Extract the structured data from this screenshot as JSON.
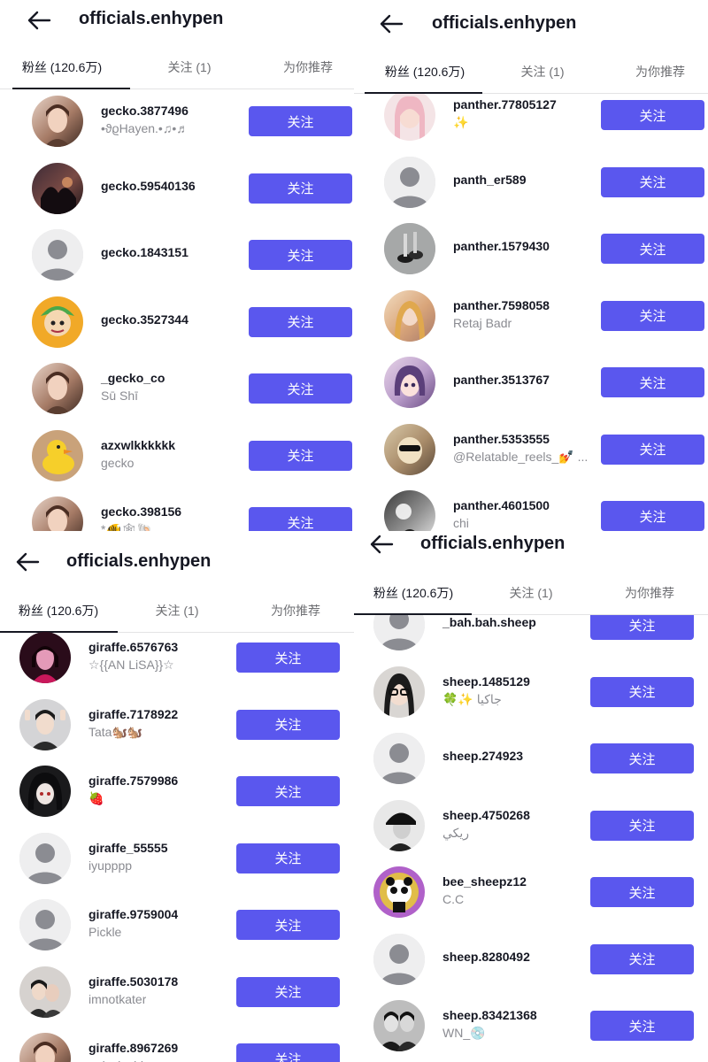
{
  "colors": {
    "accent": "#5a57ee",
    "text": "#161823",
    "muted": "#8a8b91",
    "tab_inactive": "#6e6f73",
    "divider": "#e3e3e4"
  },
  "panels": [
    {
      "back_icon": "arrow-left-icon",
      "title": "officials.enhypen",
      "tabs": [
        "粉丝 (120.6万)",
        "关注 (1)",
        "为你推荐"
      ],
      "active_tab": 0,
      "rows": [
        {
          "username": "gecko.3877496",
          "nickname": "•ϑϱHayen.•♫•♬",
          "avatar": "photo-portrait",
          "button": "关注"
        },
        {
          "username": "gecko.59540136",
          "nickname": "",
          "avatar": "photo-sunset-tree",
          "button": "关注"
        },
        {
          "username": "gecko.1843151",
          "nickname": "",
          "avatar": "default-avatar",
          "button": "关注"
        },
        {
          "username": "gecko.3527344",
          "nickname": "",
          "avatar": "cartoon-character",
          "button": "关注"
        },
        {
          "username": "_gecko_co",
          "nickname": "Sū Shī",
          "avatar": "photo-portrait",
          "button": "关注"
        },
        {
          "username": "azxwlkkkkkk",
          "nickname": "gecko",
          "avatar": "rubber-duck",
          "button": "关注"
        },
        {
          "username": "gecko.398156",
          "nickname": "*🐠🕸🐚",
          "avatar": "photo-portrait",
          "button": "关注"
        }
      ]
    },
    {
      "back_icon": "arrow-left-icon",
      "title": "officials.enhypen",
      "tabs": [
        "粉丝 (120.6万)",
        "关注 (1)",
        "为你推荐"
      ],
      "active_tab": 0,
      "rows": [
        {
          "username": "panther.77805127",
          "nickname": "✨",
          "avatar": "doll-pink",
          "button": "关注"
        },
        {
          "username": "panth_er589",
          "nickname": "",
          "avatar": "default-avatar",
          "button": "关注"
        },
        {
          "username": "panther.1579430",
          "nickname": "",
          "avatar": "photo-shoes",
          "button": "关注"
        },
        {
          "username": "panther.7598058",
          "nickname": "Retaj Badr",
          "avatar": "princess-art",
          "button": "关注"
        },
        {
          "username": "panther.3513767",
          "nickname": "",
          "avatar": "anime-girl",
          "button": "关注"
        },
        {
          "username": "panther.5353555",
          "nickname": "@Relatable_reels_💅 ...",
          "avatar": "meme-face",
          "button": "关注"
        },
        {
          "username": "panther.4601500",
          "nickname": "chi",
          "avatar": "mirror-selfie",
          "button": "关注"
        }
      ]
    },
    {
      "back_icon": "arrow-left-icon",
      "title": "officials.enhypen",
      "tabs": [
        "粉丝 (120.6万)",
        "关注 (1)",
        "为你推荐"
      ],
      "active_tab": 0,
      "rows": [
        {
          "username": "giraffe.6576763",
          "nickname": "☆{{AN LiSA}}☆",
          "avatar": "photo-pink-dark",
          "button": "关注"
        },
        {
          "username": "giraffe.7178922",
          "nickname": "Tata🐿️🐿️",
          "avatar": "photo-selfie",
          "button": "关注"
        },
        {
          "username": "giraffe.7579986",
          "nickname": "🍓",
          "avatar": "anime-dark",
          "button": "关注"
        },
        {
          "username": "giraffe_55555",
          "nickname": "iyupppp",
          "avatar": "default-avatar",
          "button": "关注"
        },
        {
          "username": "giraffe.9759004",
          "nickname": "Pickle",
          "avatar": "default-avatar",
          "button": "关注"
        },
        {
          "username": "giraffe.5030178",
          "nickname": "imnotkater",
          "avatar": "photo-couple",
          "button": "关注"
        },
        {
          "username": "giraffe.8967269",
          "nickname": "only.dasbier",
          "avatar": "photo-portrait",
          "button": "关注"
        }
      ]
    },
    {
      "back_icon": "arrow-left-icon",
      "title": "officials.enhypen",
      "tabs": [
        "粉丝 (120.6万)",
        "关注 (1)",
        "为你推荐"
      ],
      "active_tab": 0,
      "rows": [
        {
          "username": "_bah.bah.sheep",
          "nickname": "",
          "avatar": "default-avatar",
          "button": "关注"
        },
        {
          "username": "sheep.1485129",
          "nickname": "🍀✨ جاكيا",
          "avatar": "photo-glasses",
          "button": "关注"
        },
        {
          "username": "sheep.274923",
          "nickname": "",
          "avatar": "default-avatar",
          "button": "关注"
        },
        {
          "username": "sheep.4750268",
          "nickname": "ريكي",
          "avatar": "photo-bw-hat",
          "button": "关注"
        },
        {
          "username": "bee_sheepz12",
          "nickname": "C.C",
          "avatar": "panda-art",
          "button": "关注"
        },
        {
          "username": "sheep.8280492",
          "nickname": "",
          "avatar": "default-avatar",
          "button": "关注"
        },
        {
          "username": "sheep.83421368",
          "nickname": "WN_💿",
          "avatar": "photo-bw-group",
          "button": "关注"
        }
      ]
    }
  ]
}
